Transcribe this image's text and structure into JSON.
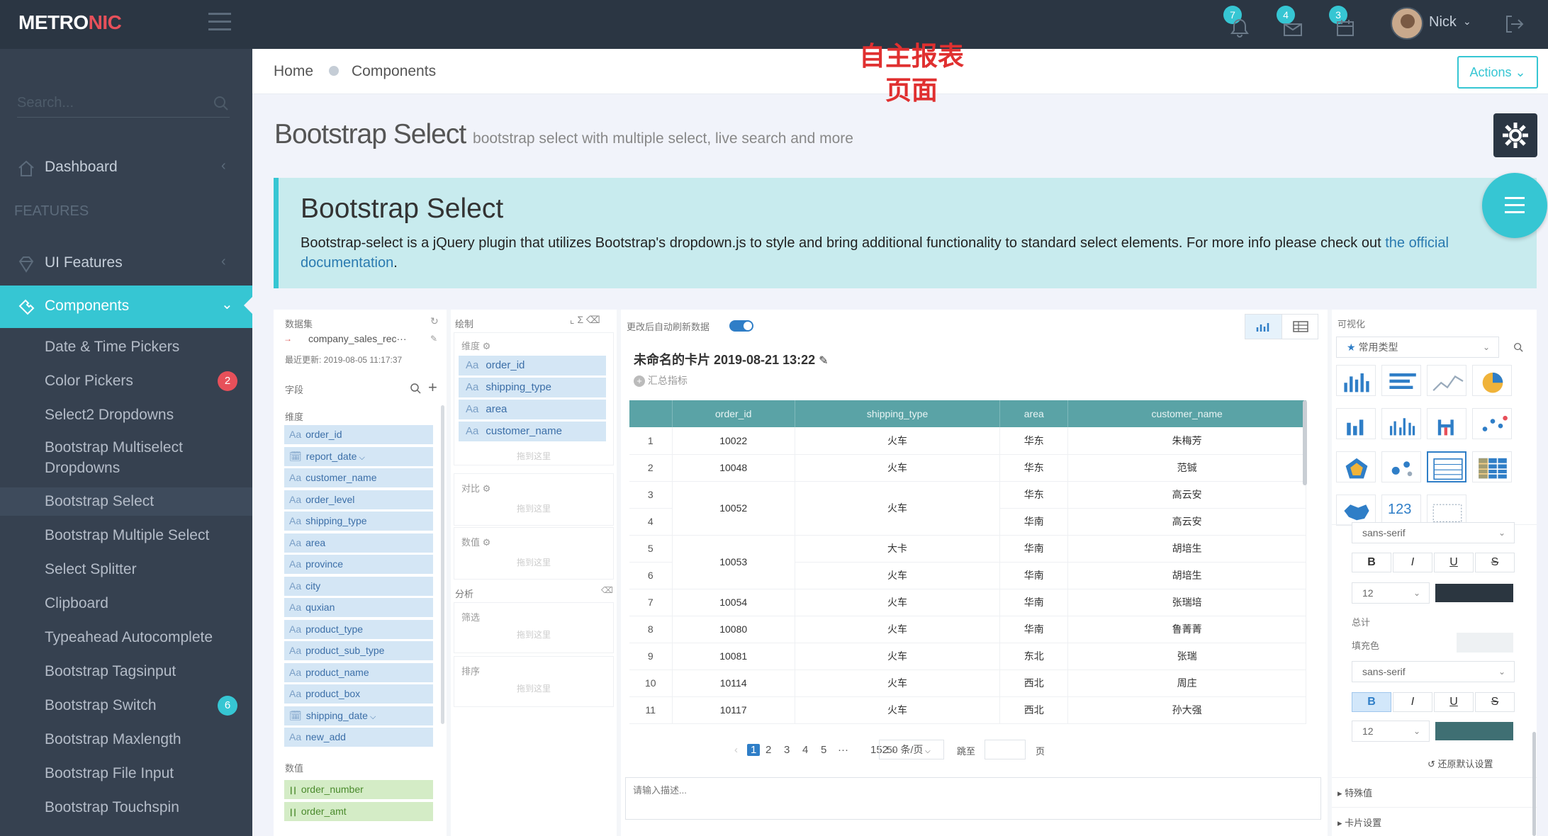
{
  "app": {
    "logo_main": "METRO",
    "logo_accent": "NIC"
  },
  "topbar": {
    "notifications": [
      {
        "icon": "bell-icon",
        "count": "7"
      },
      {
        "icon": "envelope-icon",
        "count": "4"
      },
      {
        "icon": "calendar-icon",
        "count": "3"
      }
    ],
    "user_name": "Nick"
  },
  "sidebar": {
    "search_placeholder": "Search...",
    "dashboard": "Dashboard",
    "section_heading": "FEATURES",
    "ui_features": "UI Features",
    "components": "Components",
    "sub_items": [
      {
        "label": "Date & Time Pickers"
      },
      {
        "label": "Color Pickers",
        "badge": "2",
        "badge_color": "#e7505a"
      },
      {
        "label": "Select2 Dropdowns"
      },
      {
        "label": "Bootstrap Multiselect Dropdowns"
      },
      {
        "label": "Bootstrap Select",
        "active": true
      },
      {
        "label": "Bootstrap Multiple Select"
      },
      {
        "label": "Select Splitter"
      },
      {
        "label": "Clipboard"
      },
      {
        "label": "Typeahead Autocomplete"
      },
      {
        "label": "Bootstrap Tagsinput"
      },
      {
        "label": "Bootstrap Switch",
        "badge": "6",
        "badge_color": "#36c6d3"
      },
      {
        "label": "Bootstrap Maxlength"
      },
      {
        "label": "Bootstrap File Input"
      },
      {
        "label": "Bootstrap Touchspin"
      }
    ]
  },
  "breadcrumb": {
    "home": "Home",
    "current": "Components"
  },
  "annotation": {
    "line1": "自主报表",
    "line2": "页面"
  },
  "actions_label": "Actions",
  "page": {
    "title": "Bootstrap Select",
    "subtitle": "bootstrap select with multiple select, live search and more"
  },
  "note": {
    "title": "Bootstrap Select",
    "text": "Bootstrap-select is a jQuery plugin that utilizes Bootstrap's dropdown.js to style and bring additional functionality to standard select elements. For more info please check out",
    "link": "the official documentation",
    "end": "."
  },
  "report": {
    "dataset_label": "数据集",
    "dataset_name": "company_sales_rec···",
    "updated": "最近更新: 2019-08-05 11:17:37",
    "fields_label": "字段",
    "dimension_label": "维度",
    "dimensions": [
      {
        "name": "order_id",
        "type": "Aa"
      },
      {
        "name": "report_date",
        "type": "date"
      },
      {
        "name": "customer_name",
        "type": "Aa"
      },
      {
        "name": "order_level",
        "type": "Aa"
      },
      {
        "name": "shipping_type",
        "type": "Aa"
      },
      {
        "name": "area",
        "type": "Aa"
      },
      {
        "name": "province",
        "type": "Aa"
      },
      {
        "name": "city",
        "type": "Aa"
      },
      {
        "name": "quxian",
        "type": "Aa"
      },
      {
        "name": "product_type",
        "type": "Aa"
      },
      {
        "name": "product_sub_type",
        "type": "Aa"
      },
      {
        "name": "product_name",
        "type": "Aa"
      },
      {
        "name": "product_box",
        "type": "Aa"
      },
      {
        "name": "shipping_date",
        "type": "date"
      },
      {
        "name": "new_add",
        "type": "Aa"
      }
    ],
    "measure_label": "数值",
    "measures": [
      "order_number",
      "order_amt"
    ],
    "draw_label": "绘制",
    "draw_dim_label": "维度",
    "draw_dims": [
      "order_id",
      "shipping_type",
      "area",
      "customer_name"
    ],
    "drop_here": "拖到这里",
    "compare_label": "对比",
    "value_label": "数值",
    "analysis_label": "分析",
    "filter_label": "筛选",
    "sort_label": "排序",
    "auto_refresh": "更改后自动刷新数据",
    "card_title": "未命名的卡片 2019-08-21 13:22",
    "summary_label": "汇总指标",
    "table": {
      "columns": [
        "order_id",
        "shipping_type",
        "area",
        "customer_name"
      ],
      "rows": [
        {
          "n": "1",
          "order_id": "10022",
          "shipping_type": "火车",
          "area": "华东",
          "customer_name": "朱梅芳"
        },
        {
          "n": "2",
          "order_id": "10048",
          "shipping_type": "火车",
          "area": "华东",
          "customer_name": "范铖"
        },
        {
          "n": "3",
          "order_id": "10052",
          "shipping_type": "火车",
          "area": "华东",
          "customer_name": "高云安"
        },
        {
          "n": "4",
          "order_id": "",
          "shipping_type": "",
          "area": "华南",
          "customer_name": "高云安"
        },
        {
          "n": "5",
          "order_id": "10053",
          "shipping_type": "大卡",
          "area": "华南",
          "customer_name": "胡培生"
        },
        {
          "n": "6",
          "order_id": "",
          "shipping_type": "火车",
          "area": "华南",
          "customer_name": "胡培生"
        },
        {
          "n": "7",
          "order_id": "10054",
          "shipping_type": "火车",
          "area": "华南",
          "customer_name": "张瑞培"
        },
        {
          "n": "8",
          "order_id": "10080",
          "shipping_type": "火车",
          "area": "华南",
          "customer_name": "鲁菁菁"
        },
        {
          "n": "9",
          "order_id": "10081",
          "shipping_type": "火车",
          "area": "东北",
          "customer_name": "张瑞"
        },
        {
          "n": "10",
          "order_id": "10114",
          "shipping_type": "火车",
          "area": "西北",
          "customer_name": "周庄"
        },
        {
          "n": "11",
          "order_id": "10117",
          "shipping_type": "火车",
          "area": "西北",
          "customer_name": "孙大强"
        }
      ]
    },
    "pagination": {
      "pages": [
        "1",
        "2",
        "3",
        "4",
        "5",
        "···",
        "152"
      ],
      "current": "1",
      "page_size": "50 条/页",
      "jump_label": "跳至",
      "page_suffix": "页"
    },
    "desc_placeholder": "请输入描述...",
    "visual_label": "可视化",
    "chart_type_select": "常用类型",
    "number_label": "123",
    "font_select": "sans-serif",
    "font_size": "12",
    "total_label": "总计",
    "fill_label": "填充色",
    "reset_label": "还原默认设置",
    "special_label": "特殊值",
    "card_settings_label": "卡片设置",
    "colors": {
      "swatch1": "#2b3640",
      "swatch2": "#3f6f73"
    }
  }
}
